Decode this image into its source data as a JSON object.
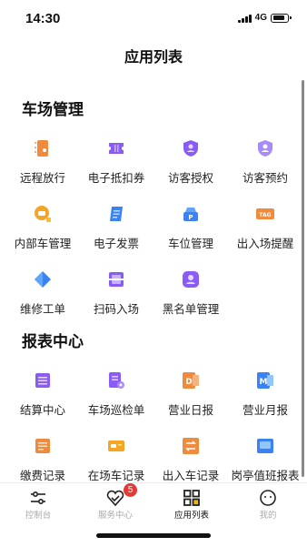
{
  "status_bar": {
    "time": "14:30",
    "network": "4G"
  },
  "header": {
    "title": "应用列表"
  },
  "sections": [
    {
      "title": "车场管理",
      "items": [
        {
          "label": "远程放行",
          "icon": "remote-release-icon",
          "color": "#f08a3c"
        },
        {
          "label": "电子抵扣券",
          "icon": "coupon-icon",
          "color": "#8a5cf6"
        },
        {
          "label": "访客授权",
          "icon": "visitor-auth-icon",
          "color": "#8a5cf6"
        },
        {
          "label": "访客预约",
          "icon": "visitor-booking-icon",
          "color": "#8a5cf6"
        },
        {
          "label": "内部车管理",
          "icon": "internal-car-icon",
          "color": "#f5a524"
        },
        {
          "label": "电子发票",
          "icon": "invoice-icon",
          "color": "#3b82f6"
        },
        {
          "label": "车位管理",
          "icon": "parking-space-icon",
          "color": "#3b82f6"
        },
        {
          "label": "出入场提醒",
          "icon": "tag-reminder-icon",
          "color": "#f08a3c"
        },
        {
          "label": "维修工单",
          "icon": "repair-order-icon",
          "color": "#3b82f6"
        },
        {
          "label": "扫码入场",
          "icon": "scan-entry-icon",
          "color": "#8a5cf6"
        },
        {
          "label": "黑名单管理",
          "icon": "blacklist-icon",
          "color": "#8a5cf6"
        }
      ]
    },
    {
      "title": "报表中心",
      "items": [
        {
          "label": "结算中心",
          "icon": "settlement-icon",
          "color": "#8a5cf6"
        },
        {
          "label": "车场巡检单",
          "icon": "inspection-icon",
          "color": "#8a5cf6"
        },
        {
          "label": "营业日报",
          "icon": "daily-report-icon",
          "color": "#f08a3c"
        },
        {
          "label": "营业月报",
          "icon": "monthly-report-icon",
          "color": "#3b82f6"
        },
        {
          "label": "缴费记录",
          "icon": "payment-record-icon",
          "color": "#f08a3c"
        },
        {
          "label": "在场车记录",
          "icon": "onsite-car-icon",
          "color": "#f5a524"
        },
        {
          "label": "出入车记录",
          "icon": "entry-exit-icon",
          "color": "#f08a3c"
        },
        {
          "label": "岗亭值班报表",
          "icon": "booth-duty-icon",
          "color": "#3b82f6"
        }
      ]
    }
  ],
  "tabbar": {
    "tabs": [
      {
        "label": "控制台",
        "icon": "sliders-icon",
        "active": false
      },
      {
        "label": "服务中心",
        "icon": "heart-service-icon",
        "active": false,
        "badge": "5"
      },
      {
        "label": "应用列表",
        "icon": "grid-icon",
        "active": true
      },
      {
        "label": "我的",
        "icon": "smile-icon",
        "active": false
      }
    ]
  },
  "colors": {
    "purple": "#8a5cf6",
    "orange": "#f08a3c",
    "blue": "#3b82f6",
    "yellow": "#f5a524",
    "badge": "#e53935",
    "active_tab": "#f2b705"
  }
}
